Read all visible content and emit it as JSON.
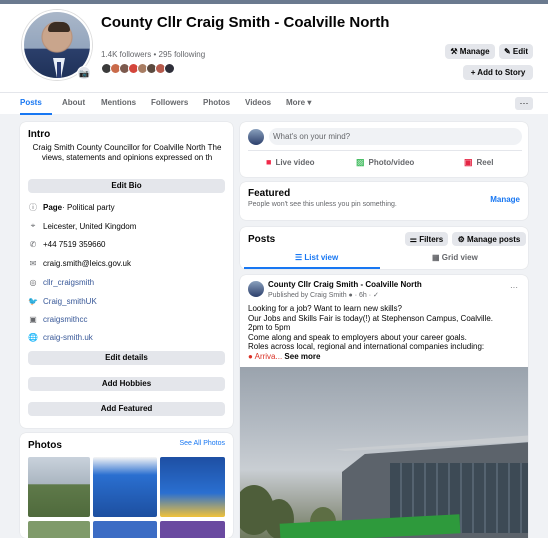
{
  "colors": {
    "accent": "#1877f2",
    "muted": "#65676b",
    "button_bg": "#e4e6eb",
    "page_bg": "#f0f2f5"
  },
  "header": {
    "page_name": "County Cllr Craig Smith - Coalville North",
    "followers_text": "1.4K followers • 295 following",
    "camera_icon": "camera-icon",
    "buttons": {
      "manage": "⚒ Manage",
      "edit": "✎ Edit",
      "add_to_story": "+ Add to Story"
    }
  },
  "tabs": {
    "items": [
      "Posts",
      "About",
      "Mentions",
      "Followers",
      "Photos",
      "Videos",
      "More ▾"
    ],
    "more_dots": "···"
  },
  "intro": {
    "title": "Intro",
    "bio": "Craig Smith County Councillor for Coalville North The views, statements and opinions expressed on th",
    "edit_bio": "Edit Bio",
    "page_type_bold": "Page",
    "page_type_rest": " · Political party",
    "location": "Leicester, United Kingdom",
    "phone": "+44 7519 359660",
    "email": "craig.smith@leics.gov.uk",
    "instagram": "cllr_craigsmith",
    "twitter": "Craig_smithUK",
    "linkedin": "craigsmithcc",
    "website": "craig-smith.uk",
    "edit_details": "Edit details",
    "add_hobbies": "Add Hobbies",
    "add_featured": "Add Featured"
  },
  "photos": {
    "title": "Photos",
    "see_all": "See All Photos"
  },
  "composer": {
    "placeholder": "What's on your mind?",
    "live_video": "Live video",
    "photo_video": "Photo/video",
    "reel": "Reel"
  },
  "featured": {
    "title": "Featured",
    "subtitle": "People won't see this unless you pin something.",
    "manage": "Manage"
  },
  "posts": {
    "title": "Posts",
    "filters": "⚌ Filters",
    "manage_posts": "⚙ Manage posts",
    "list_view": "☰ List view",
    "grid_view": "▦ Grid view"
  },
  "post": {
    "author": "County Cllr Craig Smith - Coalville North",
    "meta": "Published by Craig Smith ● · 6h · ✓",
    "dots": "···",
    "lines": [
      "Looking for a job? Want to learn new skills?",
      "Our Jobs and Skills Fair is today(!) at Stephenson Campus, Coalville.",
      "2pm to 5pm",
      "Come along and speak to employers about your career goals.",
      "Roles across local, regional and international companies including:"
    ],
    "last_line": "● Arriva... ",
    "see_more": "See more"
  }
}
